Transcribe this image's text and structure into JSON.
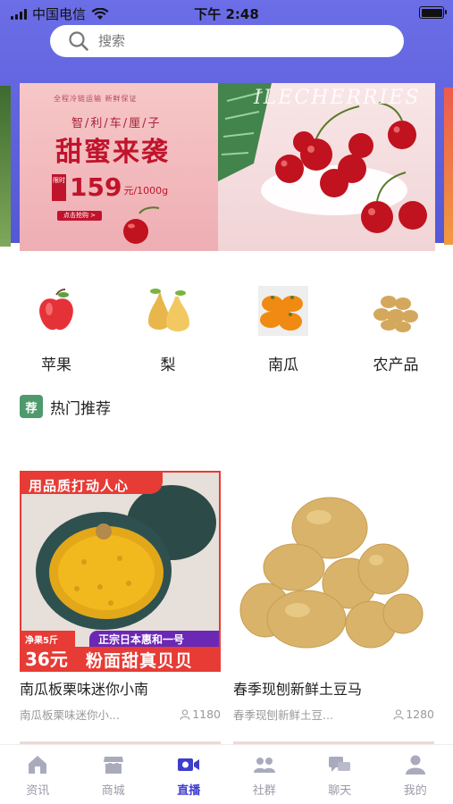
{
  "status_bar": {
    "carrier": "中国电信",
    "time": "下午 2:48"
  },
  "search": {
    "placeholder": "搜索"
  },
  "banner": {
    "tiny_text": "全程冷链运输 新鲜保证",
    "subtitle": "智/利/车/厘/子",
    "title": "甜蜜来袭",
    "price_tag": "限时",
    "price": "159",
    "price_unit": "元/1000g",
    "cta": "点击抢购 >",
    "english": "ILECHERRIES"
  },
  "categories": [
    {
      "label": "苹果",
      "icon": "apple-icon"
    },
    {
      "label": "梨",
      "icon": "pear-icon"
    },
    {
      "label": "南瓜",
      "icon": "pumpkin-icon"
    },
    {
      "label": "农产品",
      "icon": "potato-icon"
    }
  ],
  "section": {
    "title": "热门推荐",
    "icon_text": "荐"
  },
  "products": [
    {
      "name": "南瓜板栗味迷你小南",
      "subtitle": "南瓜板栗味迷你小...",
      "count": "1180",
      "promo_top": "用品质打动人心",
      "promo_left_small": "净果5斤",
      "promo_left_price": "36元",
      "promo_right_top": "正宗日本惠和一号",
      "promo_right_bottom": "粉面甜真贝贝"
    },
    {
      "name": "春季现刨新鲜土豆马",
      "subtitle": "春季现刨新鲜土豆...",
      "count": "1280"
    }
  ],
  "tabs": [
    {
      "label": "资讯",
      "icon": "home-icon",
      "active": false
    },
    {
      "label": "商城",
      "icon": "shop-icon",
      "active": false
    },
    {
      "label": "直播",
      "icon": "video-icon",
      "active": true
    },
    {
      "label": "社群",
      "icon": "group-icon",
      "active": false
    },
    {
      "label": "聊天",
      "icon": "chat-icon",
      "active": false
    },
    {
      "label": "我的",
      "icon": "profile-icon",
      "active": false
    }
  ],
  "colors": {
    "header": "#5f62df",
    "accent": "#3f3dcc",
    "promo_red": "#e73b35",
    "promo_purple": "#6a28b5"
  }
}
